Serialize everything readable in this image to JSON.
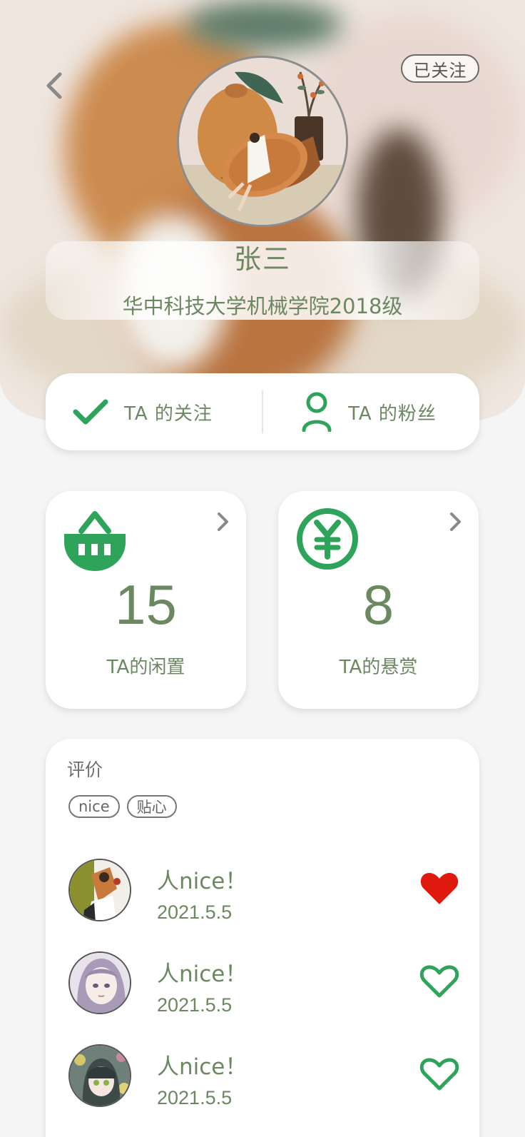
{
  "header": {
    "follow_status": "已关注"
  },
  "profile": {
    "name": "张三",
    "school": "华中科技大学机械学院2018级"
  },
  "social": {
    "following_label": "TA 的关注",
    "fans_label": "TA 的粉丝"
  },
  "stats": [
    {
      "icon": "basket-icon",
      "value": "15",
      "label": "TA的闲置"
    },
    {
      "icon": "yen-icon",
      "value": "8",
      "label": "TA的悬赏"
    }
  ],
  "reviews": {
    "title": "评价",
    "tags": [
      "nice",
      "贴心"
    ],
    "items": [
      {
        "text": "人nice！",
        "date": "2021.5.5",
        "liked": true
      },
      {
        "text": "人nice！",
        "date": "2021.5.5",
        "liked": false
      },
      {
        "text": "人nice！",
        "date": "2021.5.5",
        "liked": false
      }
    ]
  },
  "colors": {
    "accent_green": "#2ea35a",
    "text_green": "#6b8860",
    "heart_red": "#e0190f"
  }
}
